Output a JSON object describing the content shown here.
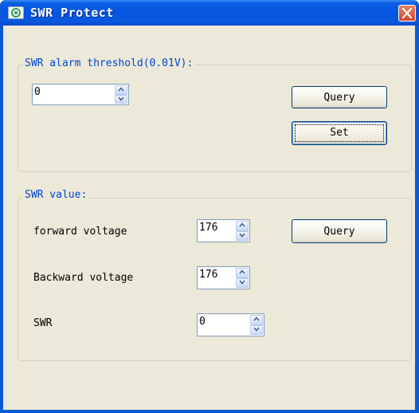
{
  "window": {
    "title": "SWR Protect"
  },
  "threshold": {
    "legend": "SWR alarm threshold(0.01V):",
    "value": "0",
    "query_label": "Query",
    "set_label": "Set"
  },
  "swr": {
    "legend": "SWR value:",
    "forward_label": "forward voltage",
    "forward_value": "176",
    "backward_label": "Backward voltage",
    "backward_value": "176",
    "swr_label": "SWR",
    "swr_value": "0",
    "query_label": "Query"
  },
  "icons": {
    "app": "app-icon",
    "close": "close-icon",
    "spin_up": "chevron-up-icon",
    "spin_down": "chevron-down-icon"
  },
  "colors": {
    "titlebar": "#0554e0",
    "client_bg": "#ece9d8",
    "legend_text": "#0046d5",
    "close_button": "#d24a2a"
  }
}
